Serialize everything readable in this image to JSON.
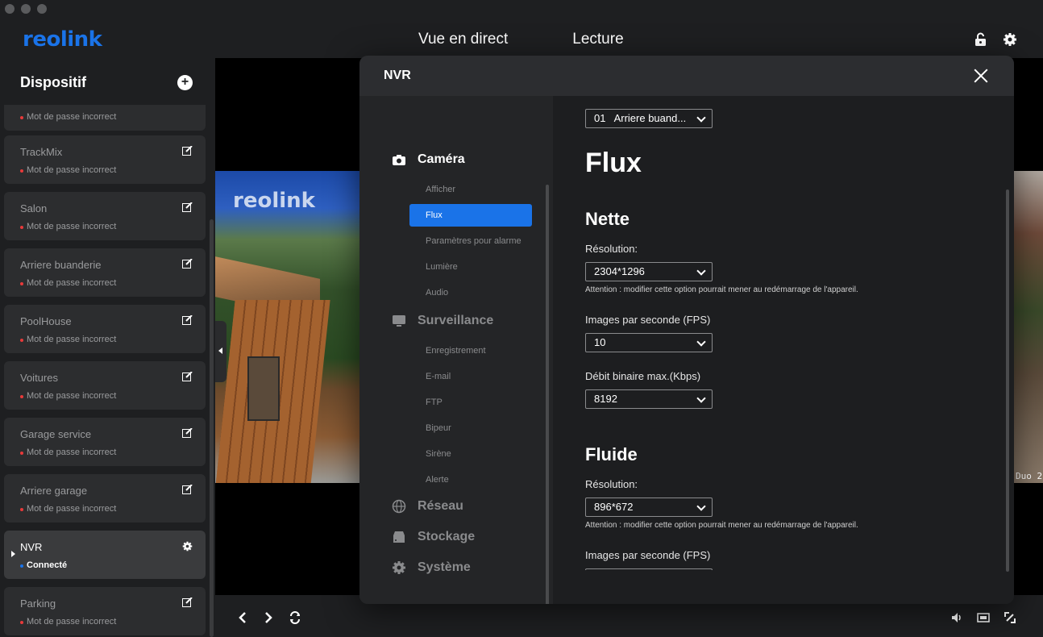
{
  "app": {
    "logo": "reolink"
  },
  "header": {
    "tabs": [
      {
        "label": "Vue en direct"
      },
      {
        "label": "Lecture"
      }
    ]
  },
  "sidebar": {
    "title": "Dispositif",
    "devices": [
      {
        "name": "",
        "status": "Mot de passe incorrect"
      },
      {
        "name": "TrackMix",
        "status": "Mot de passe incorrect"
      },
      {
        "name": "Salon",
        "status": "Mot de passe incorrect"
      },
      {
        "name": "Arriere buanderie",
        "status": "Mot de passe incorrect"
      },
      {
        "name": "PoolHouse",
        "status": "Mot de passe incorrect"
      },
      {
        "name": "Voitures",
        "status": "Mot de passe incorrect"
      },
      {
        "name": "Garage service",
        "status": "Mot de passe incorrect"
      },
      {
        "name": "Arriere garage",
        "status": "Mot de passe incorrect"
      },
      {
        "name": "NVR",
        "status": "Connecté"
      },
      {
        "name": "Parking",
        "status": "Mot de passe incorrect"
      }
    ]
  },
  "camera": {
    "left_watermark": "reolink",
    "right_label": "Duo 2"
  },
  "modal": {
    "title": "NVR",
    "nav": {
      "camera": {
        "label": "Caméra",
        "items": [
          "Afficher",
          "Flux",
          "Paramètres pour alarme",
          "Lumière",
          "Audio"
        ]
      },
      "surveillance": {
        "label": "Surveillance",
        "items": [
          "Enregistrement",
          "E-mail",
          "FTP",
          "Bipeur",
          "Sirène",
          "Alerte"
        ]
      },
      "reseau": {
        "label": "Réseau"
      },
      "stockage": {
        "label": "Stockage"
      },
      "systeme": {
        "label": "Système"
      }
    },
    "content": {
      "channel_select": "01   Arriere buand...",
      "title": "Flux",
      "nette": {
        "heading": "Nette",
        "resolution_label": "Résolution:",
        "resolution_value": "2304*1296",
        "warning": "Attention : modifier cette option pourrait mener au redémarrage de l'appareil.",
        "fps_label": "Images par seconde (FPS)",
        "fps_value": "10",
        "bitrate_label": "Débit binaire max.(Kbps)",
        "bitrate_value": "8192"
      },
      "fluide": {
        "heading": "Fluide",
        "resolution_label": "Résolution:",
        "resolution_value": "896*672",
        "warning": "Attention : modifier cette option pourrait mener au redémarrage de l'appareil.",
        "fps_label": "Images par seconde (FPS)"
      }
    }
  },
  "colors": {
    "accent": "#1a73e8",
    "error_dot": "#e83a3a"
  }
}
